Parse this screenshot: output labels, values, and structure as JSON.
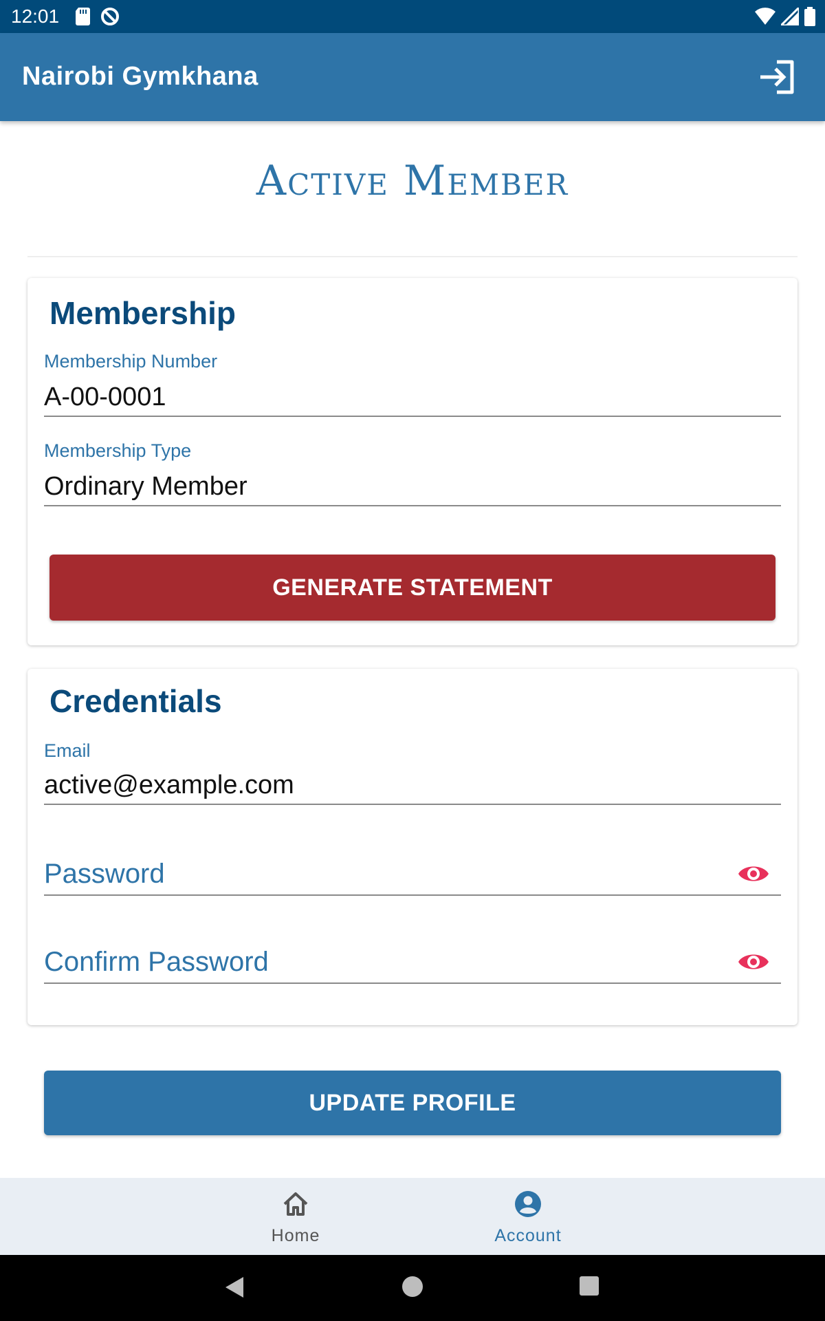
{
  "status_bar": {
    "time": "12:01",
    "left_icons": [
      "sd-card-icon",
      "no-disturb-icon"
    ],
    "right_icons": [
      "wifi-icon",
      "signal-icon",
      "battery-icon"
    ]
  },
  "app_bar": {
    "title": "Nairobi Gymkhana",
    "action_icon": "logout-icon"
  },
  "page": {
    "heading": "Active Member"
  },
  "membership_card": {
    "title": "Membership",
    "fields": [
      {
        "label": "Membership Number",
        "value": "A-00-0001"
      },
      {
        "label": "Membership Type",
        "value": "Ordinary Member"
      }
    ],
    "button_label": "GENERATE STATEMENT"
  },
  "credentials_card": {
    "title": "Credentials",
    "email": {
      "label": "Email",
      "value": "active@example.com"
    },
    "password": {
      "placeholder": "Password",
      "icon": "eye-icon"
    },
    "confirm_password": {
      "placeholder": "Confirm Password",
      "icon": "eye-icon"
    }
  },
  "update_button_label": "UPDATE PROFILE",
  "bottom_nav": {
    "items": [
      {
        "label": "Home",
        "icon": "home-icon",
        "active": false
      },
      {
        "label": "Account",
        "icon": "account-icon",
        "active": true
      }
    ]
  },
  "colors": {
    "primary": "#2e74a8",
    "status_bar": "#014a7a",
    "danger_button": "#a52a2f",
    "eye_icon": "#e8315b"
  }
}
